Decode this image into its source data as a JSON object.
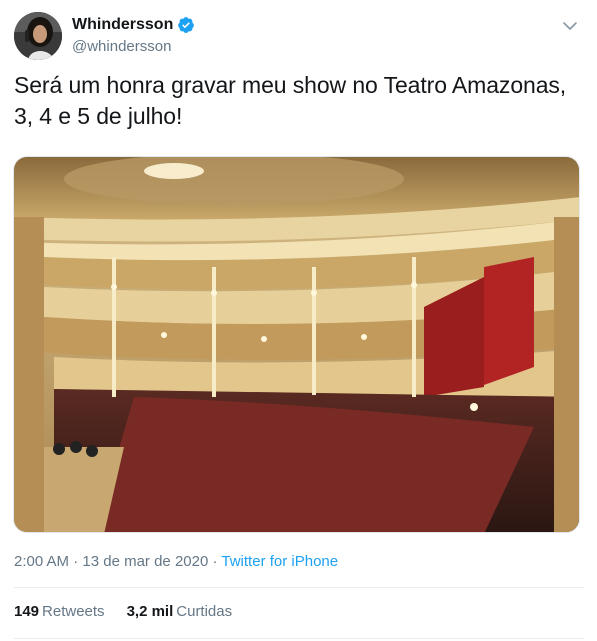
{
  "author": {
    "display_name": "Whindersson",
    "handle": "@whindersson",
    "verified": true
  },
  "tweet": {
    "text": "Será um honra gravar meu show no Teatro Amazonas, 3, 4 e 5 de julho!",
    "time": "2:00 AM",
    "separator": " · ",
    "date": "13 de mar de 2020",
    "source": "Twitter for iPhone"
  },
  "stats": {
    "retweets_count": "149",
    "retweets_label": "Retweets",
    "likes_count": "3,2 mil",
    "likes_label": "Curtidas"
  },
  "icons": {
    "verified": "verified-badge-icon",
    "menu": "chevron-down-icon"
  },
  "colors": {
    "accent": "#1da1f2",
    "muted": "#657786",
    "text": "#14171a",
    "divider": "#e6ecf0"
  }
}
